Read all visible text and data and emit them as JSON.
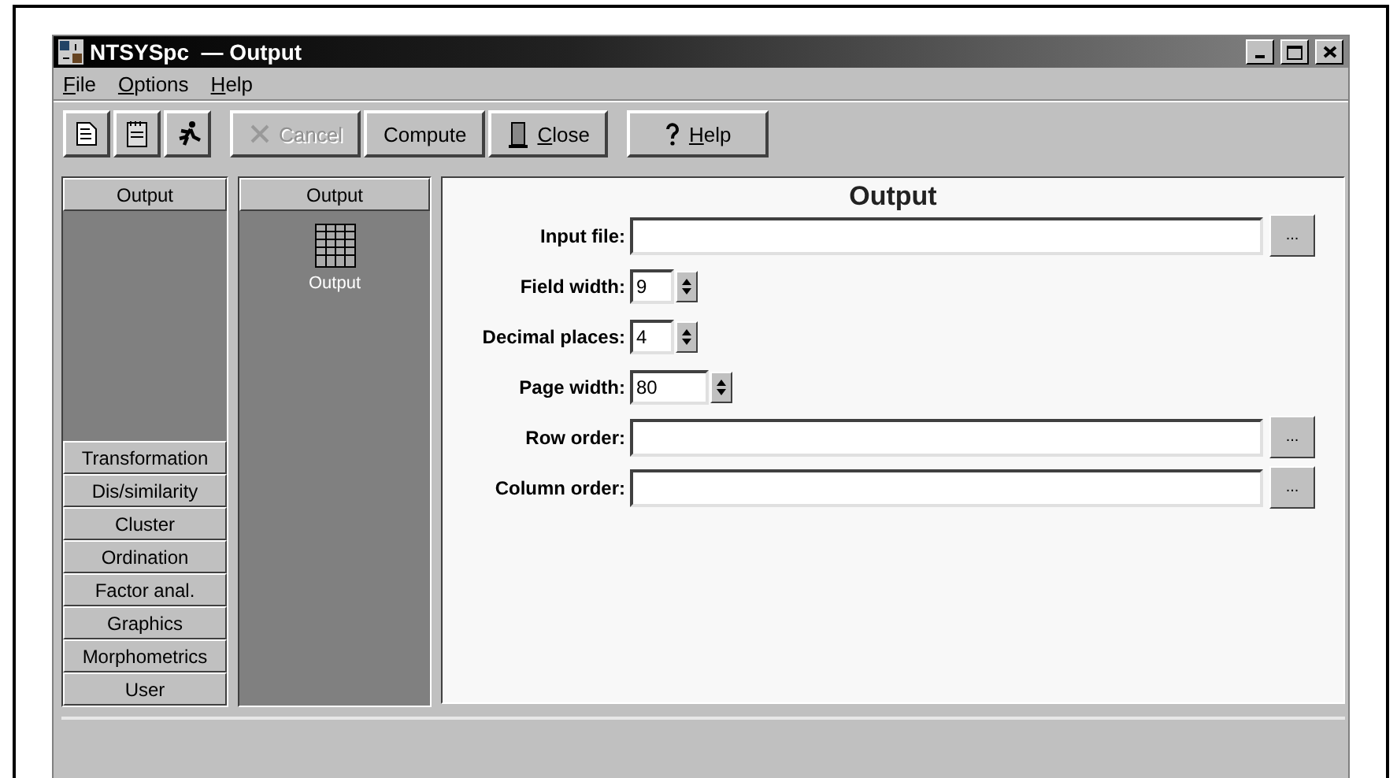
{
  "window": {
    "title": "NTSYSpc  — Output"
  },
  "menu": [
    {
      "label": "File"
    },
    {
      "label": "Options"
    },
    {
      "label": "Help"
    }
  ],
  "toolbar": {
    "icon_buttons": [
      {
        "kind": "document"
      },
      {
        "kind": "notepad"
      },
      {
        "kind": "runner"
      }
    ],
    "buttons": [
      {
        "label": "Cancel",
        "kind": "cancel",
        "disabled": true
      },
      {
        "label": "Compute",
        "kind": "plain",
        "disabled": false
      },
      {
        "label": "Close",
        "kind": "close",
        "disabled": false
      },
      {
        "label": "Help",
        "kind": "help",
        "disabled": false
      }
    ]
  },
  "categories": {
    "header": "Output",
    "items": [
      {
        "label": "Transformation"
      },
      {
        "label": "Dis/similarity"
      },
      {
        "label": "Cluster"
      },
      {
        "label": "Ordination"
      },
      {
        "label": "Factor anal."
      },
      {
        "label": "Graphics"
      },
      {
        "label": "Morphometrics"
      },
      {
        "label": "User"
      }
    ]
  },
  "modules": {
    "header": "Output",
    "items": [
      {
        "label": "Output"
      }
    ]
  },
  "form": {
    "title": "Output",
    "fields": [
      {
        "label": "Input file:",
        "kind": "file"
      },
      {
        "label": "Field width:",
        "kind": "spin",
        "value": "9"
      },
      {
        "label": "Decimal places:",
        "kind": "spin",
        "value": "4"
      },
      {
        "label": "Page width:",
        "kind": "widespin",
        "value": "80"
      },
      {
        "label": "Row order:",
        "kind": "file"
      },
      {
        "label": "Column order:",
        "kind": "file"
      }
    ],
    "browse_label": "..."
  }
}
